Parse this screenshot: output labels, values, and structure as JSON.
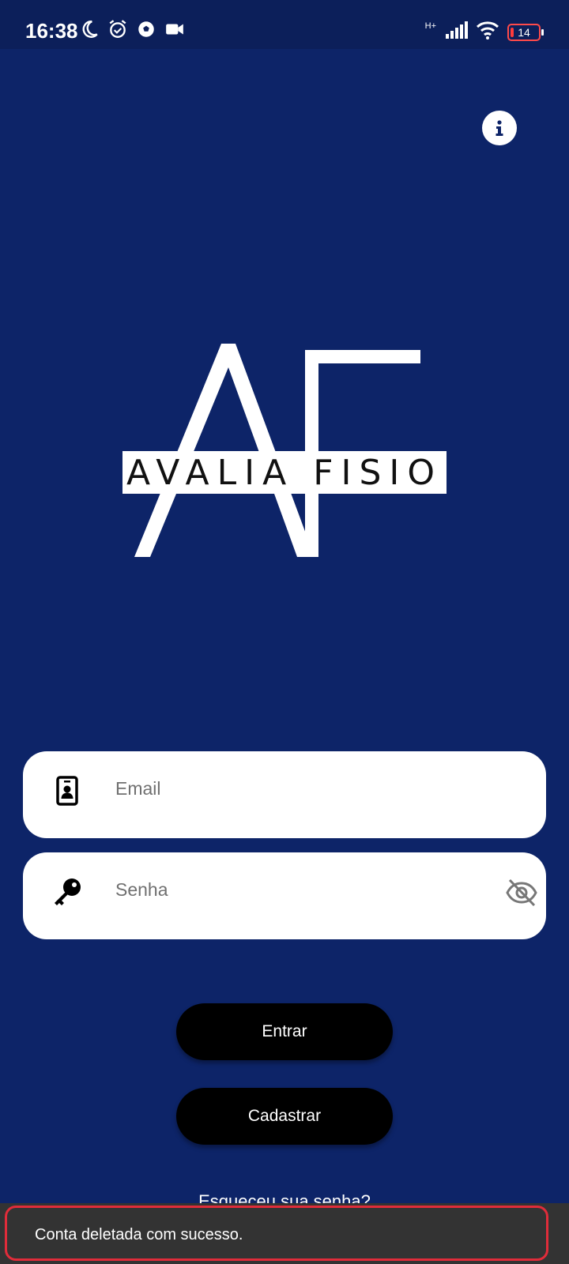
{
  "status_bar": {
    "time": "16:38",
    "network_type": "H+",
    "battery_level": "14",
    "left_icons": [
      "moon-icon",
      "alarm-icon",
      "soccer-ball-icon",
      "video-camera-icon"
    ],
    "right_icons": [
      "signal-icon",
      "wifi-icon",
      "battery-icon"
    ]
  },
  "header": {
    "info_icon": "info-icon"
  },
  "logo": {
    "monogram": "AF",
    "text": "AVALIA FISIO"
  },
  "login_form": {
    "email_placeholder": "Email",
    "email_icon": "id-badge-icon",
    "password_placeholder": "Senha",
    "password_icon": "key-icon",
    "password_visibility_icon": "eye-off-icon"
  },
  "actions": {
    "login_label": "Entrar",
    "register_label": "Cadastrar",
    "forgot_password_label": "Esqueceu sua senha?"
  },
  "snackbar": {
    "message": "Conta deletada com sucesso."
  },
  "colors": {
    "background": "#0d2468",
    "status_bar": "#0c1f5a",
    "button": "#000000",
    "snackbar": "#333333",
    "highlight_outline": "#e02c3a"
  }
}
